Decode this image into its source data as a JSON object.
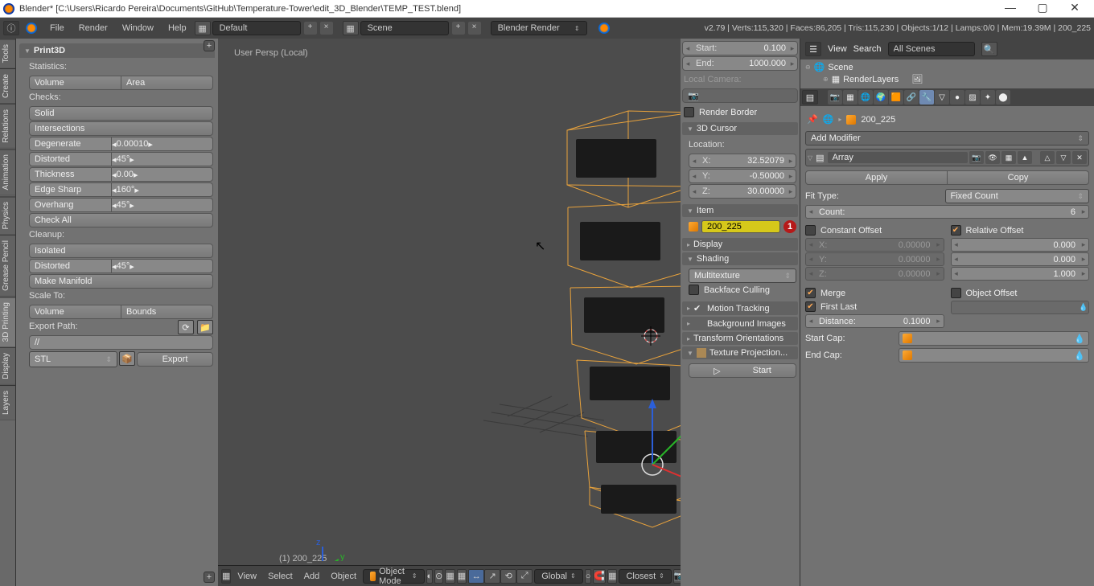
{
  "window": {
    "title": "Blender* [C:\\Users\\Ricardo Pereira\\Documents\\GitHub\\Temperature-Tower\\edit_3D_Blender\\TEMP_TEST.blend]"
  },
  "menu": {
    "file": "File",
    "render": "Render",
    "window": "Window",
    "help": "Help"
  },
  "top": {
    "layout": "Default",
    "scene": "Scene",
    "renderer": "Blender Render",
    "stats": "v2.79 | Verts:115,320 | Faces:86,205 | Tris:115,230 | Objects:1/12 | Lamps:0/0 | Mem:19.39M | 200_225"
  },
  "vtabs": {
    "tools": "Tools",
    "create": "Create",
    "relations": "Relations",
    "animation": "Animation",
    "physics": "Physics",
    "grease": "Grease Pencil",
    "print3d": "3D Printing",
    "display_t": "Display",
    "layers_t": "Layers"
  },
  "print3d": {
    "title": "Print3D",
    "stats": "Statistics:",
    "volume": "Volume",
    "area": "Area",
    "checks": "Checks:",
    "solid": "Solid",
    "intersections": "Intersections",
    "degenerate": "Degenerate",
    "degenerate_v": "0.00010",
    "distorted": "Distorted",
    "distorted_v": "45°",
    "thickness": "Thickness",
    "thickness_v": "0.00",
    "edgesharp": "Edge Sharp",
    "edgesharp_v": "160°",
    "overhang": "Overhang",
    "overhang_v": "45°",
    "checkall": "Check All",
    "cleanup": "Cleanup:",
    "isolated": "Isolated",
    "distorted2": "Distorted",
    "distorted2_v": "45°",
    "manifold": "Make Manifold",
    "scaleto": "Scale To:",
    "volume2": "Volume",
    "bounds": "Bounds",
    "exportpath": "Export Path:",
    "path": "//",
    "format": "STL",
    "export": "Export"
  },
  "viewport": {
    "persp": "User Persp (Local)",
    "obj": "(1) 200_225"
  },
  "bottom": {
    "view": "View",
    "select": "Select",
    "add": "Add",
    "object": "Object",
    "mode": "Object Mode",
    "orient": "Global",
    "snap": "Closest"
  },
  "n": {
    "start": "Start:",
    "start_v": "0.100",
    "end": "End:",
    "end_v": "1000.000",
    "localcam": "Local Camera:",
    "renderborder": "Render Border",
    "cursor": "3D Cursor",
    "location": "Location:",
    "x": "X:",
    "xv": "32.52079",
    "y": "Y:",
    "yv": "-0.50000",
    "z": "Z:",
    "zv": "30.00000",
    "item": "Item",
    "item_name": "200_225",
    "badge": "1",
    "display": "Display",
    "shading": "Shading",
    "shade_type": "Multitexture",
    "backface": "Backface Culling",
    "motion": "Motion Tracking",
    "bg": "Background Images",
    "transform": "Transform Orientations",
    "texproj": "Texture Projection...",
    "start_btn": "Start"
  },
  "rp": {
    "view": "View",
    "search": "Search",
    "all": "All Scenes",
    "scene": "Scene",
    "renderlayers": "RenderLayers",
    "objname": "200_225",
    "addmod": "Add Modifier",
    "modname": "Array",
    "apply": "Apply",
    "copy": "Copy",
    "fittype": "Fit Type:",
    "fixedcount": "Fixed Count",
    "count": "Count:",
    "count_v": "6",
    "constoff": "Constant Offset",
    "reloff": "Relative Offset",
    "cx": "X:",
    "cxv": "0.00000",
    "rxv": "0.000",
    "cy": "Y:",
    "cyv": "0.00000",
    "ryv": "0.000",
    "cz": "Z:",
    "czv": "0.00000",
    "rzv": "1.000",
    "merge": "Merge",
    "objoff": "Object Offset",
    "firstlast": "First Last",
    "distance": "Distance:",
    "distance_v": "0.1000",
    "startcap": "Start Cap:",
    "endcap": "End Cap:"
  }
}
